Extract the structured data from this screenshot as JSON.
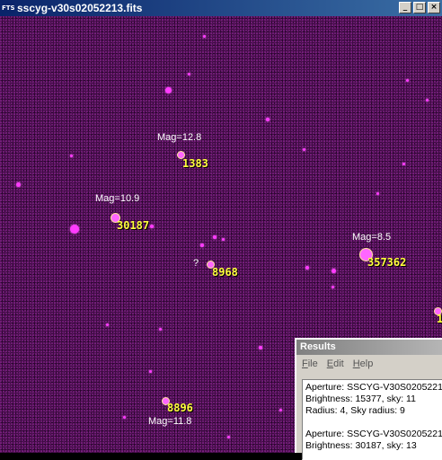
{
  "window": {
    "title": "sscyg-v30s02052213.fits",
    "icon_label": "FTS",
    "buttons": {
      "minimize": "_",
      "maximize": "□",
      "close": "×"
    }
  },
  "annotations": [
    {
      "mag": "Mag=12.8",
      "brightness": "1383"
    },
    {
      "mag": "Mag=10.9",
      "brightness": "30187"
    },
    {
      "mag": "?",
      "brightness": "8968"
    },
    {
      "mag": "Mag=8.5",
      "brightness": "357362"
    },
    {
      "mag": "Mag=11.8",
      "brightness": "8896"
    }
  ],
  "edge_label": "1",
  "results": {
    "title": "Results",
    "menu": [
      "File",
      "Edit",
      "Help"
    ],
    "lines": [
      "Aperture: SSCYG-V30S0205221",
      "Brightness: 15377, sky: 11",
      "Radius: 4, Sky radius: 9",
      "",
      "Aperture: SSCYG-V30S0205221",
      "Brightness: 30187, sky: 13"
    ]
  },
  "colors": {
    "background": "#3e0b42",
    "star": "#ff3bff",
    "brightness_label": "#ffff3c",
    "mag_label": "#ffffff",
    "titlebar": "#0a246a"
  }
}
